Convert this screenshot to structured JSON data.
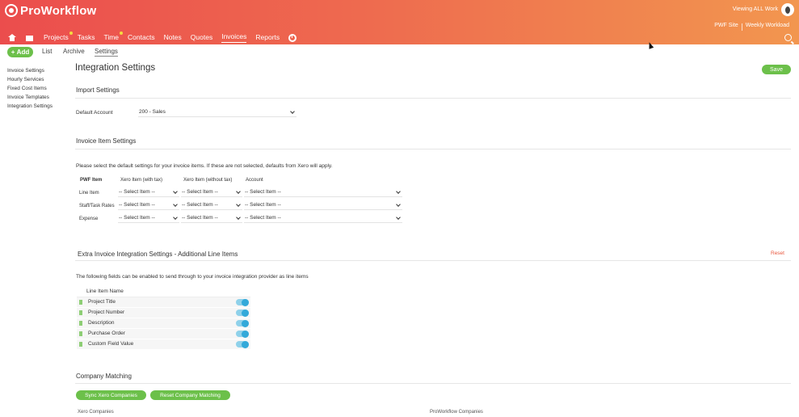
{
  "app": {
    "brand": "ProWorkflow",
    "viewing": "Viewing ALL Work"
  },
  "toplinks": [
    "PWF Site",
    "Weekly Workload"
  ],
  "nav": [
    "Projects",
    "Tasks",
    "Time",
    "Contacts",
    "Notes",
    "Quotes",
    "Invoices",
    "Reports"
  ],
  "subnav": {
    "add": "Add",
    "tabs": [
      "List",
      "Archive",
      "Settings"
    ]
  },
  "sidebar": [
    "Invoice Settings",
    "Hourly Services",
    "Fixed Cost Items",
    "Invoice Templates",
    "Integration Settings"
  ],
  "page": {
    "title": "Integration Settings",
    "save": "Save"
  },
  "import": {
    "heading": "Import Settings",
    "default_account_label": "Default Account",
    "default_account_value": "200 - Sales"
  },
  "invoice_items": {
    "heading": "Invoice Item Settings",
    "note": "Please select the default settings for your invoice items. If these are not selected, defaults from Xero will apply.",
    "columns": [
      "PWF Item",
      "Xero Item (with tax)",
      "Xero Item (without tax)",
      "Account"
    ],
    "rows": [
      {
        "name": "Line Item",
        "with_tax": "-- Select Item --",
        "without_tax": "-- Select Item --",
        "account": "-- Select Item --"
      },
      {
        "name": "Staff/Task Rates",
        "with_tax": "-- Select Item --",
        "without_tax": "-- Select Item --",
        "account": "-- Select Item --"
      },
      {
        "name": "Expense",
        "with_tax": "-- Select Item --",
        "without_tax": "-- Select Item --",
        "account": "-- Select Item --"
      }
    ]
  },
  "extra": {
    "heading": "Extra Invoice Integration Settings - Additional Line Items",
    "reset": "Reset",
    "note": "The following fields can be enabled to send through to your invoice integration provider as line items",
    "column": "Line Item Name",
    "items": [
      "Project Title",
      "Project Number",
      "Description",
      "Purchase Order",
      "Custom Field Value"
    ]
  },
  "company": {
    "heading": "Company Matching",
    "sync_button": "Sync Xero Companies",
    "reset_button": "Reset Company Matching",
    "left_col": "Xero Companies",
    "right_col": "ProWorkflow Companies"
  },
  "colors": {
    "accent_green": "#6cc04a",
    "header_start": "#eb4d4d",
    "header_end": "#f2964f",
    "toggle_blue": "#33a9d9"
  }
}
